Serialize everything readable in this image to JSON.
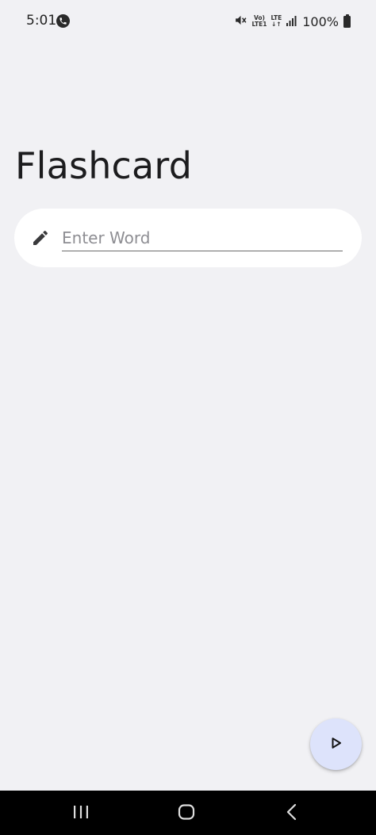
{
  "status_bar": {
    "time": "5:01",
    "net_top_1": "Vo)",
    "net_bottom_1": "LTE1",
    "net_top_2": "LTE",
    "net_bottom_2": "↓↑",
    "battery": "100%"
  },
  "header": {
    "title": "Flashcard"
  },
  "entry": {
    "placeholder": "Enter Word",
    "value": ""
  },
  "icons": {
    "status_call": "phone-icon",
    "mute": "mute-icon",
    "signal": "signal-icon",
    "battery": "battery-icon",
    "entry": "pencil-icon",
    "fab": "play-icon",
    "nav_recents": "recents-icon",
    "nav_home": "home-icon",
    "nav_back": "back-icon"
  },
  "colors": {
    "background": "#f1f1f4",
    "card": "#ffffff",
    "fab": "#dde3fb",
    "nav_bar": "#000000"
  }
}
